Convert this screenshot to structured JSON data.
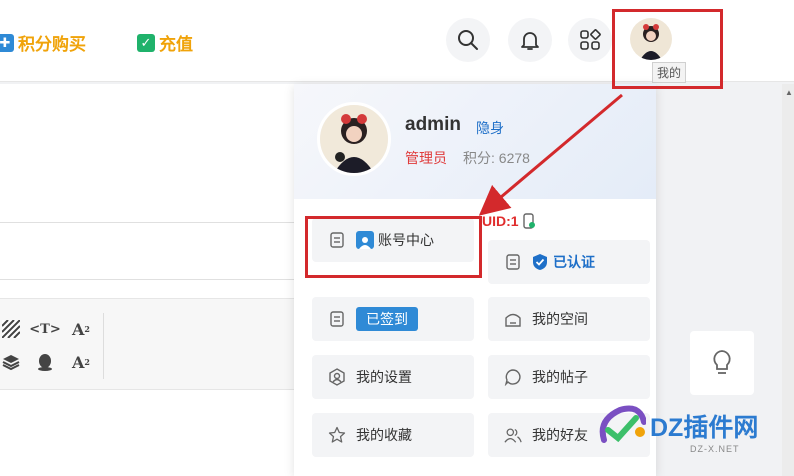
{
  "topbar": {
    "points_buy": "积分购买",
    "recharge": "充值",
    "points_icon_color": "#2f8ad6",
    "recharge_icon_color": "#1fb26b"
  },
  "avatar_tooltip": "我的",
  "panel": {
    "username": "admin",
    "stealth": "隐身",
    "role": "管理员",
    "credits": "积分: 6278",
    "uid": "UID:1",
    "items": [
      {
        "label": "账号中心",
        "icon": "document-icon"
      },
      {
        "label": "已认证",
        "icon": "document-icon"
      },
      {
        "label": "已签到",
        "icon": "document-icon"
      },
      {
        "label": "我的空间",
        "icon": "home-icon"
      },
      {
        "label": "我的设置",
        "icon": "settings-icon"
      },
      {
        "label": "我的帖子",
        "icon": "chat-icon"
      },
      {
        "label": "我的收藏",
        "icon": "star-icon"
      },
      {
        "label": "我的好友",
        "icon": "users-icon"
      }
    ]
  },
  "watermark": {
    "text": "DZ插件网",
    "url": "DZ-X.NET"
  },
  "colors": {
    "accent_red": "#d3292c",
    "accent_blue": "#2f8ad6",
    "link_orange": "#f0a30a"
  }
}
